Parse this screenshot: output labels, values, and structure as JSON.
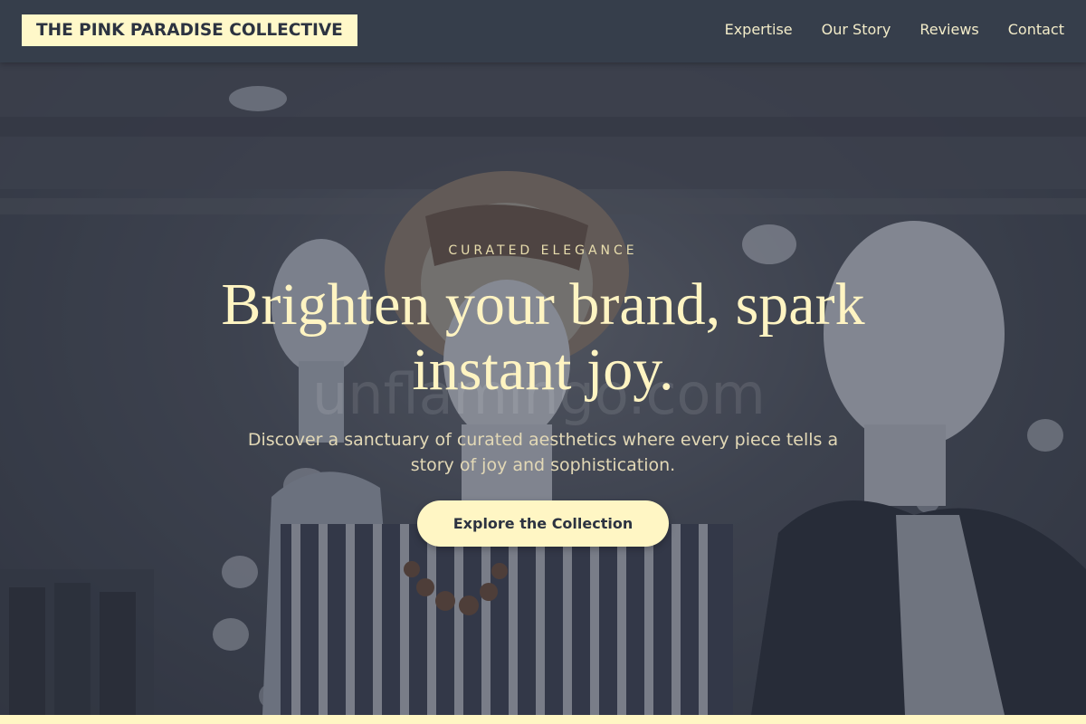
{
  "header": {
    "logo": "THE PINK PARADISE COLLECTIVE",
    "nav": [
      {
        "label": "Expertise"
      },
      {
        "label": "Our Story"
      },
      {
        "label": "Reviews"
      },
      {
        "label": "Contact"
      }
    ]
  },
  "hero": {
    "eyebrow": "CURATED ELEGANCE",
    "headline": "Brighten your brand, spark instant joy.",
    "subtext": "Discover a sanctuary of curated aesthetics where every piece tells a story of joy and sophistication.",
    "cta_label": "Explore the Collection",
    "watermark": "unflamingo.com",
    "image": "mannequins-boutique-photo"
  },
  "colors": {
    "header_bg": "#363e4b",
    "accent_cream": "#fff6c4",
    "headline": "#fff4c2",
    "text_dark": "#2c3341"
  }
}
